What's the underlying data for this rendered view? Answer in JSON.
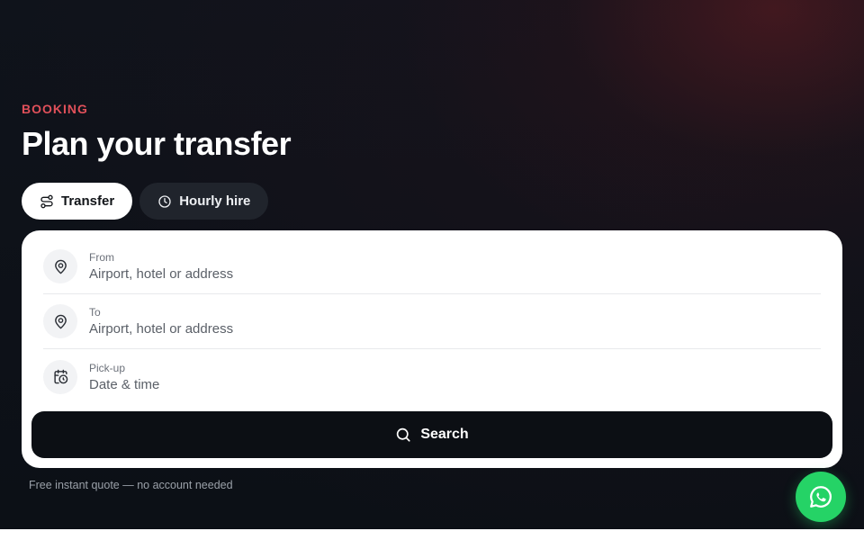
{
  "hero": {
    "kicker": "BOOKING",
    "title": "Plan your transfer"
  },
  "tabs": [
    {
      "label": "Transfer",
      "icon": "route-icon",
      "active": true
    },
    {
      "label": "Hourly hire",
      "icon": "clock-icon",
      "active": false
    }
  ],
  "form": {
    "from": {
      "label": "From",
      "placeholder": "Airport, hotel or address",
      "icon": "map-pin-icon"
    },
    "to": {
      "label": "To",
      "placeholder": "Airport, hotel or address",
      "icon": "map-pin-icon"
    },
    "pickup": {
      "label": "Pick-up",
      "placeholder": "Date & time",
      "icon": "calendar-clock-icon"
    },
    "search_label": "Search"
  },
  "footer_note": "Free instant quote — no account needed",
  "whatsapp": {
    "icon": "whatsapp-icon",
    "color": "#25d366"
  },
  "colors": {
    "accent": "#e0505a",
    "background": "#0d1118",
    "button": "#0c0f14"
  }
}
